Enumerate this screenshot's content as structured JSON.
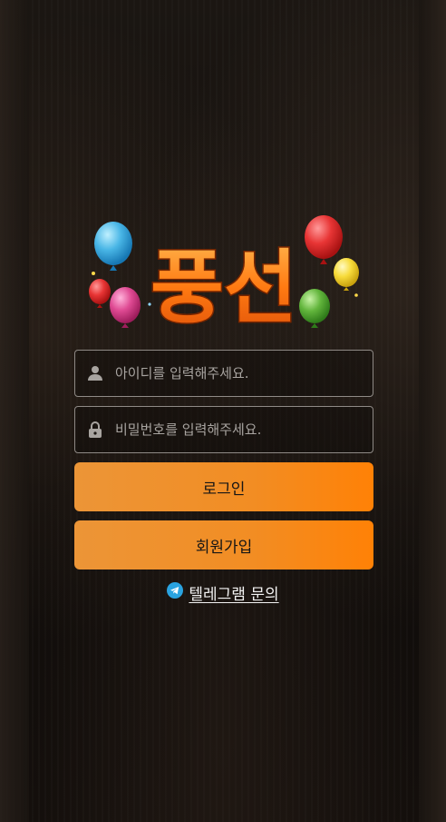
{
  "logo": {
    "text": "풍선"
  },
  "login_form": {
    "id_placeholder": "아이디를 입력해주세요.",
    "password_placeholder": "비밀번호를 입력해주세요."
  },
  "buttons": {
    "login_label": "로그인",
    "signup_label": "회원가입"
  },
  "telegram": {
    "label": "텔레그램 문의"
  },
  "colors": {
    "button_gradient_start": "#ec9537",
    "button_gradient_end": "#ff8106",
    "logo_orange": "#ff7a12",
    "telegram_blue": "#2aa3e0"
  },
  "icons": {
    "id_field": "user-icon",
    "password_field": "lock-icon",
    "telegram": "telegram-icon"
  }
}
